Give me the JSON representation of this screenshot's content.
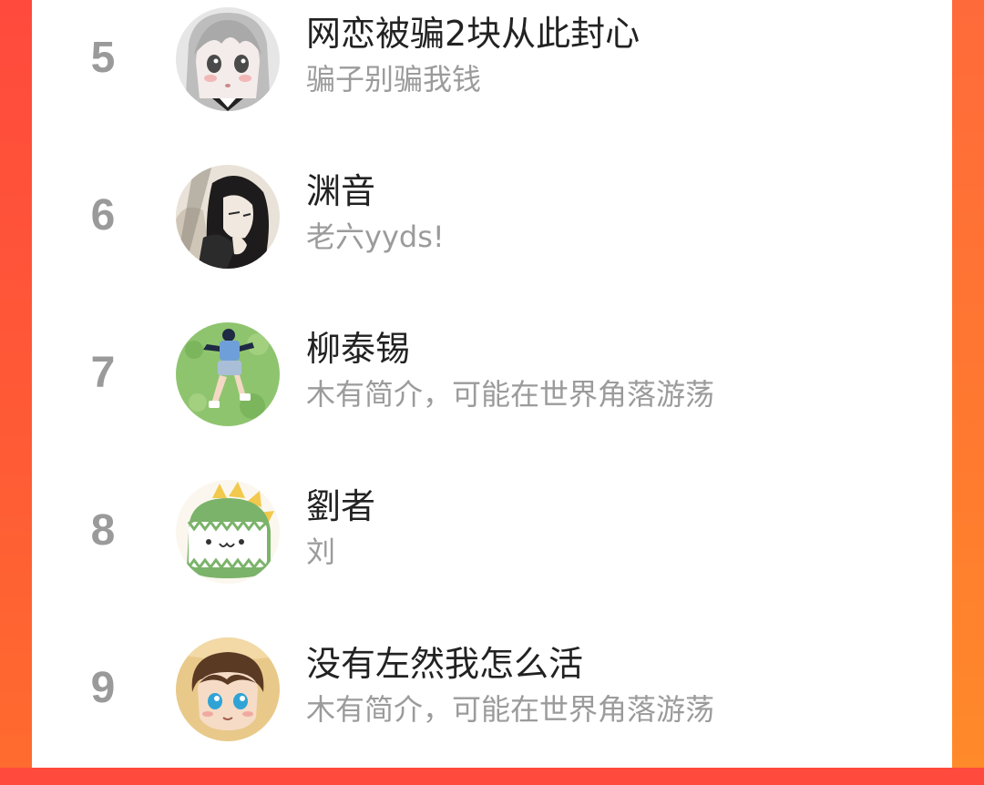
{
  "colors": {
    "background_gradient_start": "#ff4a3d",
    "background_gradient_end": "#ff6b2e",
    "panel": "#ffffff",
    "rank_text": "#9a9a9a",
    "name_text": "#222222",
    "bio_text": "#9b9b9b"
  },
  "list": {
    "items": [
      {
        "rank": "5",
        "name": "网恋被骗2块从此封心",
        "bio": "骗子别骗我钱",
        "avatar_icon": "anime-girl-avatar-icon"
      },
      {
        "rank": "6",
        "name": "渊音",
        "bio": "老六yyds!",
        "avatar_icon": "dark-hair-sketch-avatar-icon"
      },
      {
        "rank": "7",
        "name": "柳泰锡",
        "bio": "木有简介，可能在世界角落游荡",
        "avatar_icon": "boy-lying-on-grass-avatar-icon"
      },
      {
        "rank": "8",
        "name": "劉者",
        "bio": "刘",
        "avatar_icon": "green-dinosaur-avatar-icon"
      },
      {
        "rank": "9",
        "name": "没有左然我怎么活",
        "bio": "木有简介，可能在世界角落游荡",
        "avatar_icon": "chibi-boy-avatar-icon"
      }
    ]
  }
}
